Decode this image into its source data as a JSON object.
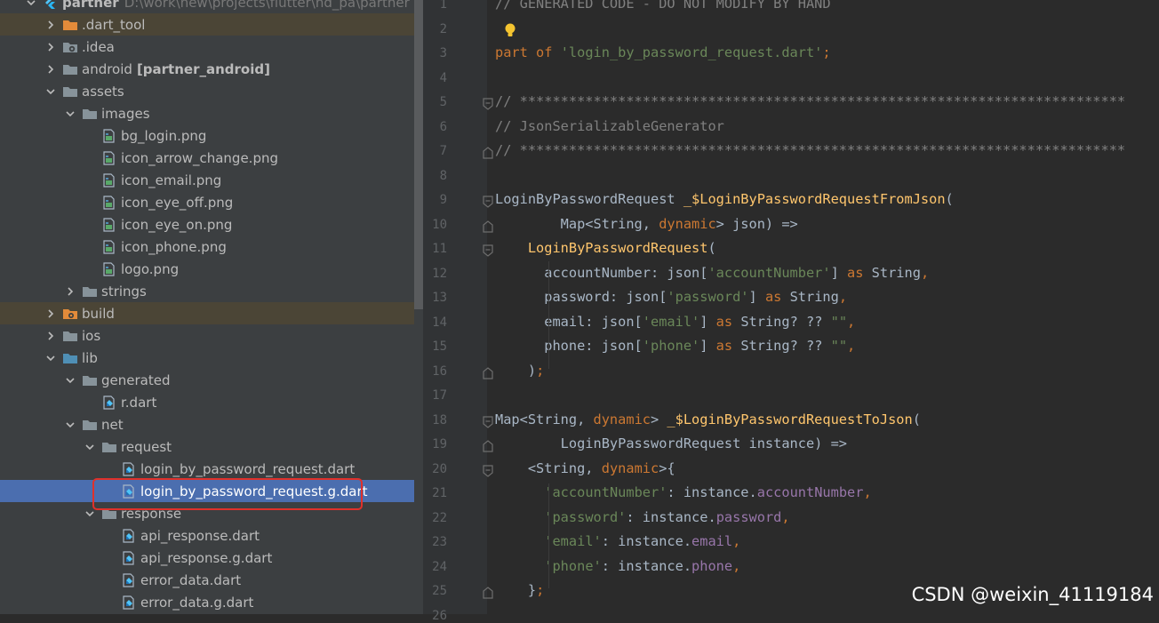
{
  "project": {
    "root": {
      "name": "partner",
      "path": "D:\\work\\new\\projects\\flutter\\nd_pa\\partner"
    },
    "items": [
      {
        "label": "partner",
        "path": "D:\\work\\new\\projects\\flutter\\nd_pa\\partner",
        "icon": "flutter-project-icon",
        "depth": 0,
        "arrow": "down",
        "state": "normal"
      },
      {
        "label": ".dart_tool",
        "icon": "excluded-folder-icon",
        "depth": 1,
        "arrow": "right",
        "state": "excluded"
      },
      {
        "label": ".idea",
        "icon": "settings-folder-icon",
        "depth": 1,
        "arrow": "right",
        "state": "normal"
      },
      {
        "label": "android",
        "module": "[partner_android]",
        "icon": "folder-icon",
        "depth": 1,
        "arrow": "right",
        "state": "normal"
      },
      {
        "label": "assets",
        "icon": "folder-icon",
        "depth": 1,
        "arrow": "down",
        "state": "normal"
      },
      {
        "label": "images",
        "icon": "folder-icon",
        "depth": 2,
        "arrow": "down",
        "state": "normal"
      },
      {
        "label": "bg_login.png",
        "icon": "image-file-icon",
        "depth": 3,
        "arrow": "none",
        "state": "normal"
      },
      {
        "label": "icon_arrow_change.png",
        "icon": "image-file-icon",
        "depth": 3,
        "arrow": "none",
        "state": "normal"
      },
      {
        "label": "icon_email.png",
        "icon": "image-file-icon",
        "depth": 3,
        "arrow": "none",
        "state": "normal"
      },
      {
        "label": "icon_eye_off.png",
        "icon": "image-file-icon",
        "depth": 3,
        "arrow": "none",
        "state": "normal"
      },
      {
        "label": "icon_eye_on.png",
        "icon": "image-file-icon",
        "depth": 3,
        "arrow": "none",
        "state": "normal"
      },
      {
        "label": "icon_phone.png",
        "icon": "image-file-icon",
        "depth": 3,
        "arrow": "none",
        "state": "normal"
      },
      {
        "label": "logo.png",
        "icon": "image-file-icon",
        "depth": 3,
        "arrow": "none",
        "state": "normal"
      },
      {
        "label": "strings",
        "icon": "folder-icon",
        "depth": 2,
        "arrow": "right",
        "state": "normal"
      },
      {
        "label": "build",
        "icon": "build-folder-icon",
        "depth": 1,
        "arrow": "right",
        "state": "excluded"
      },
      {
        "label": "ios",
        "icon": "folder-icon",
        "depth": 1,
        "arrow": "right",
        "state": "normal"
      },
      {
        "label": "lib",
        "icon": "source-folder-icon",
        "depth": 1,
        "arrow": "down",
        "state": "normal"
      },
      {
        "label": "generated",
        "icon": "folder-icon",
        "depth": 2,
        "arrow": "down",
        "state": "normal"
      },
      {
        "label": "r.dart",
        "icon": "dart-file-icon",
        "depth": 3,
        "arrow": "none",
        "state": "normal"
      },
      {
        "label": "net",
        "icon": "folder-icon",
        "depth": 2,
        "arrow": "down",
        "state": "normal"
      },
      {
        "label": "request",
        "icon": "folder-icon",
        "depth": 3,
        "arrow": "down",
        "state": "normal"
      },
      {
        "label": "login_by_password_request.dart",
        "icon": "dart-file-icon",
        "depth": 4,
        "arrow": "none",
        "state": "normal"
      },
      {
        "label": "login_by_password_request.g.dart",
        "icon": "dart-file-icon",
        "depth": 4,
        "arrow": "none",
        "state": "selected"
      },
      {
        "label": "response",
        "icon": "folder-icon",
        "depth": 3,
        "arrow": "down",
        "state": "normal"
      },
      {
        "label": "api_response.dart",
        "icon": "dart-file-icon",
        "depth": 4,
        "arrow": "none",
        "state": "normal"
      },
      {
        "label": "api_response.g.dart",
        "icon": "dart-file-icon",
        "depth": 4,
        "arrow": "none",
        "state": "normal"
      },
      {
        "label": "error_data.dart",
        "icon": "dart-file-icon",
        "depth": 4,
        "arrow": "none",
        "state": "normal"
      },
      {
        "label": "error_data.g.dart",
        "icon": "dart-file-icon",
        "depth": 4,
        "arrow": "none",
        "state": "normal"
      }
    ]
  },
  "editor": {
    "lines": [
      {
        "n": "1",
        "fold": "",
        "tokens": [
          [
            "c",
            "// GENERATED CODE - DO NOT MODIFY BY HAND"
          ]
        ]
      },
      {
        "n": "2",
        "fold": "",
        "bulb": true,
        "tokens": []
      },
      {
        "n": "3",
        "fold": "",
        "tokens": [
          [
            "k",
            "part of "
          ],
          [
            "s",
            "'login_by_password_request.dart'"
          ],
          [
            "k",
            ";"
          ]
        ]
      },
      {
        "n": "4",
        "fold": "",
        "tokens": []
      },
      {
        "n": "5",
        "fold": "start",
        "tokens": [
          [
            "c",
            "// **************************************************************************"
          ]
        ]
      },
      {
        "n": "6",
        "fold": "",
        "tokens": [
          [
            "c",
            "// JsonSerializableGenerator"
          ]
        ]
      },
      {
        "n": "7",
        "fold": "end",
        "tokens": [
          [
            "c",
            "// **************************************************************************"
          ]
        ]
      },
      {
        "n": "8",
        "fold": "",
        "tokens": []
      },
      {
        "n": "9",
        "fold": "start",
        "tokens": [
          [
            "t",
            "LoginByPasswordRequest "
          ],
          [
            "f",
            "_$LoginByPasswordRequestFromJson"
          ],
          [
            "t",
            "("
          ]
        ]
      },
      {
        "n": "10",
        "fold": "end",
        "tokens": [
          [
            "t",
            "        Map<String, "
          ],
          [
            "k",
            "dynamic"
          ],
          [
            "t",
            "> json) =>"
          ]
        ]
      },
      {
        "n": "11",
        "fold": "start",
        "tokens": [
          [
            "t",
            "    "
          ],
          [
            "f",
            "LoginByPasswordRequest"
          ],
          [
            "t",
            "("
          ]
        ]
      },
      {
        "n": "12",
        "fold": "",
        "tokens": [
          [
            "t",
            "      accountNumber: json["
          ],
          [
            "s",
            "'accountNumber'"
          ],
          [
            "t",
            "] "
          ],
          [
            "k",
            "as "
          ],
          [
            "t",
            "String"
          ],
          [
            "k",
            ","
          ]
        ]
      },
      {
        "n": "13",
        "fold": "",
        "tokens": [
          [
            "t",
            "      password: json["
          ],
          [
            "s",
            "'password'"
          ],
          [
            "t",
            "] "
          ],
          [
            "k",
            "as "
          ],
          [
            "t",
            "String"
          ],
          [
            "k",
            ","
          ]
        ]
      },
      {
        "n": "14",
        "fold": "",
        "tokens": [
          [
            "t",
            "      email: json["
          ],
          [
            "s",
            "'email'"
          ],
          [
            "t",
            "] "
          ],
          [
            "k",
            "as "
          ],
          [
            "t",
            "String? ?? "
          ],
          [
            "s",
            "\"\""
          ],
          [
            "k",
            ","
          ]
        ]
      },
      {
        "n": "15",
        "fold": "",
        "tokens": [
          [
            "t",
            "      phone: json["
          ],
          [
            "s",
            "'phone'"
          ],
          [
            "t",
            "] "
          ],
          [
            "k",
            "as "
          ],
          [
            "t",
            "String? ?? "
          ],
          [
            "s",
            "\"\""
          ],
          [
            "k",
            ","
          ]
        ]
      },
      {
        "n": "16",
        "fold": "end",
        "tokens": [
          [
            "t",
            "    )"
          ],
          [
            "k",
            ";"
          ]
        ]
      },
      {
        "n": "17",
        "fold": "",
        "tokens": []
      },
      {
        "n": "18",
        "fold": "start",
        "tokens": [
          [
            "t",
            "Map<String, "
          ],
          [
            "k",
            "dynamic"
          ],
          [
            "t",
            "> "
          ],
          [
            "f",
            "_$LoginByPasswordRequestToJson"
          ],
          [
            "t",
            "("
          ]
        ]
      },
      {
        "n": "19",
        "fold": "end",
        "tokens": [
          [
            "t",
            "        LoginByPasswordRequest instance) =>"
          ]
        ]
      },
      {
        "n": "20",
        "fold": "start",
        "tokens": [
          [
            "t",
            "    <String, "
          ],
          [
            "k",
            "dynamic"
          ],
          [
            "t",
            ">{"
          ]
        ]
      },
      {
        "n": "21",
        "fold": "",
        "tokens": [
          [
            "t",
            "      "
          ],
          [
            "s",
            "'accountNumber'"
          ],
          [
            "t",
            ": instance."
          ],
          [
            "p",
            "accountNumber"
          ],
          [
            "k",
            ","
          ]
        ]
      },
      {
        "n": "22",
        "fold": "",
        "tokens": [
          [
            "t",
            "      "
          ],
          [
            "s",
            "'password'"
          ],
          [
            "t",
            ": instance."
          ],
          [
            "p",
            "password"
          ],
          [
            "k",
            ","
          ]
        ]
      },
      {
        "n": "23",
        "fold": "",
        "tokens": [
          [
            "t",
            "      "
          ],
          [
            "s",
            "'email'"
          ],
          [
            "t",
            ": instance."
          ],
          [
            "p",
            "email"
          ],
          [
            "k",
            ","
          ]
        ]
      },
      {
        "n": "24",
        "fold": "",
        "tokens": [
          [
            "t",
            "      "
          ],
          [
            "s",
            "'phone'"
          ],
          [
            "t",
            ": instance."
          ],
          [
            "p",
            "phone"
          ],
          [
            "k",
            ","
          ]
        ]
      },
      {
        "n": "25",
        "fold": "end",
        "tokens": [
          [
            "t",
            "    }"
          ],
          [
            "k",
            ";"
          ]
        ]
      },
      {
        "n": "26",
        "fold": "",
        "tokens": []
      }
    ]
  },
  "watermark": "CSDN @weixin_41119184",
  "colors": {
    "tree_bg": "#3c3f41",
    "editor_bg": "#2b2b2b",
    "selected_row": "#4b6eaf",
    "excluded_row": "#4b4536",
    "highlight_box": "#e0312b",
    "keyword": "#cc7832",
    "string": "#6a8759",
    "comment": "#808080",
    "function": "#ffc66d",
    "property": "#9876aa"
  }
}
